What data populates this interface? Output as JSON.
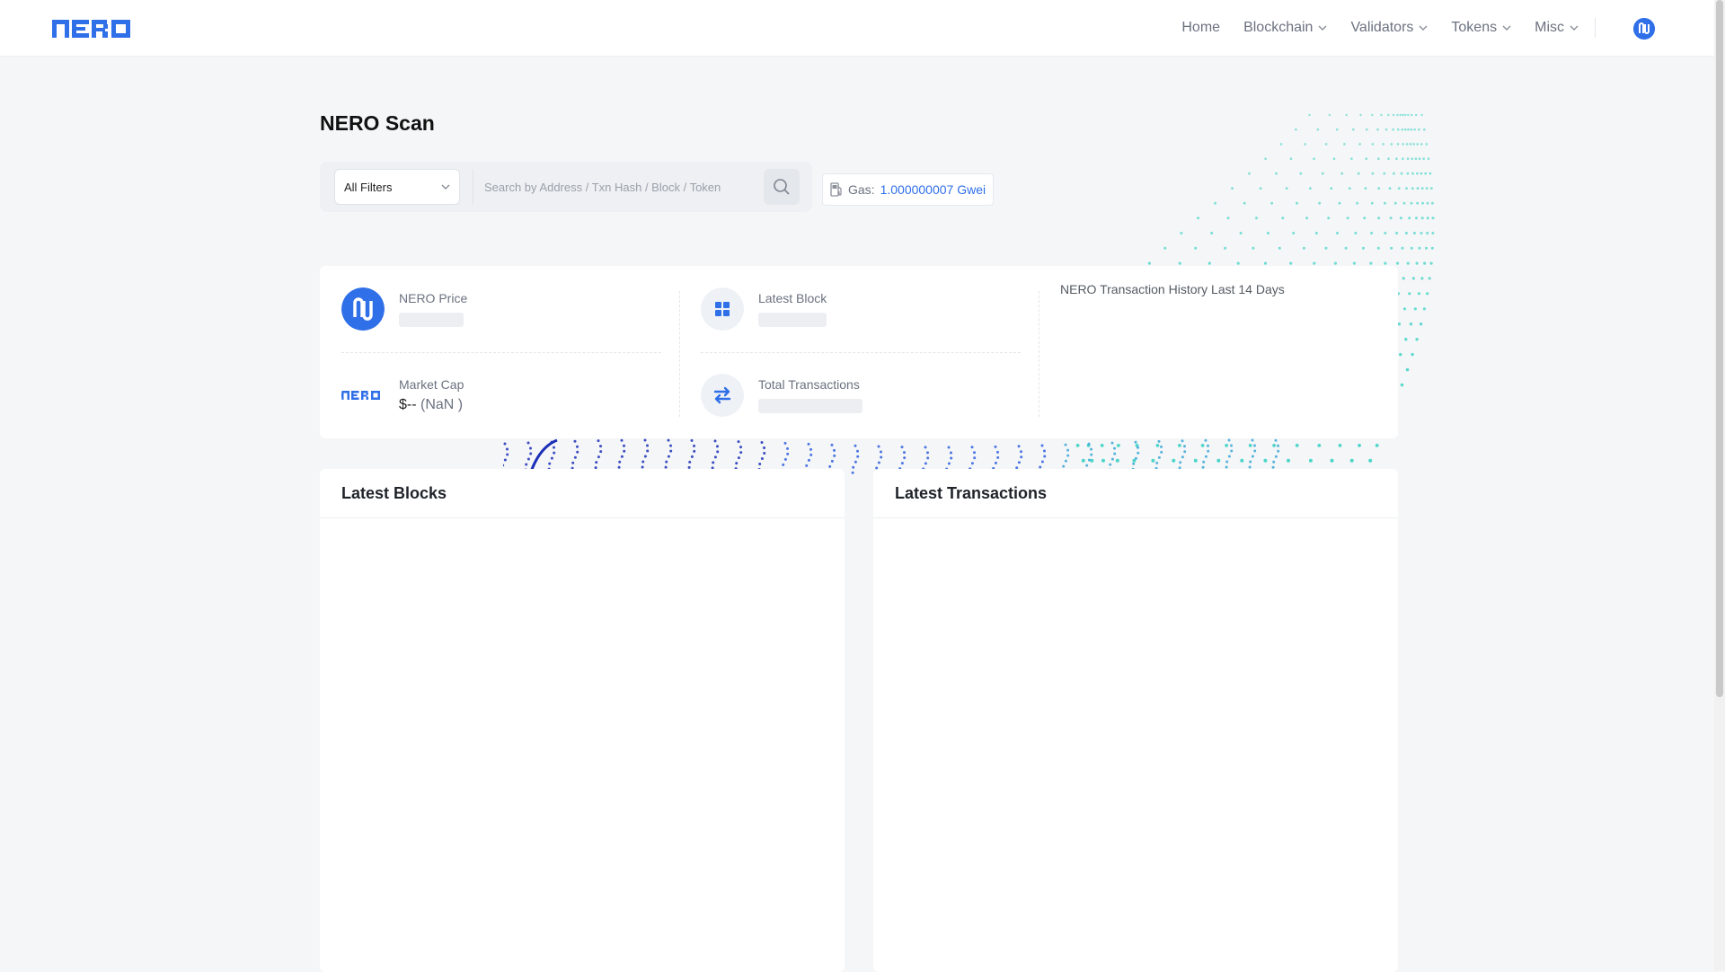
{
  "header": {
    "logo_text": "NERO",
    "nav": [
      {
        "label": "Home",
        "has_dropdown": false
      },
      {
        "label": "Blockchain",
        "has_dropdown": true
      },
      {
        "label": "Validators",
        "has_dropdown": true
      },
      {
        "label": "Tokens",
        "has_dropdown": true
      },
      {
        "label": "Misc",
        "has_dropdown": true
      }
    ],
    "avatar_icon": "nero-logo-icon"
  },
  "page": {
    "title": "NERO Scan"
  },
  "search": {
    "filter_label": "All Filters",
    "placeholder": "Search by Address / Txn Hash / Block / Token",
    "value": ""
  },
  "gas": {
    "label": "Gas:",
    "value": "1.000000007 Gwei"
  },
  "stats": {
    "nero_price": {
      "label": "NERO Price"
    },
    "latest_block": {
      "label": "Latest Block"
    },
    "market_cap": {
      "label": "Market Cap",
      "value": "$--",
      "change": "(NaN )"
    },
    "total_transactions": {
      "label": "Total Transactions"
    },
    "chart_title": "NERO Transaction History Last 14 Days"
  },
  "panels": {
    "latest_blocks": {
      "title": "Latest Blocks"
    },
    "latest_transactions": {
      "title": "Latest Transactions"
    }
  },
  "colors": {
    "brand": "#2f6fe8",
    "background": "#f5f6f7",
    "card": "#ffffff",
    "deco_teal": "#3fd3c6",
    "deco_navy": "#1b2fb8"
  }
}
